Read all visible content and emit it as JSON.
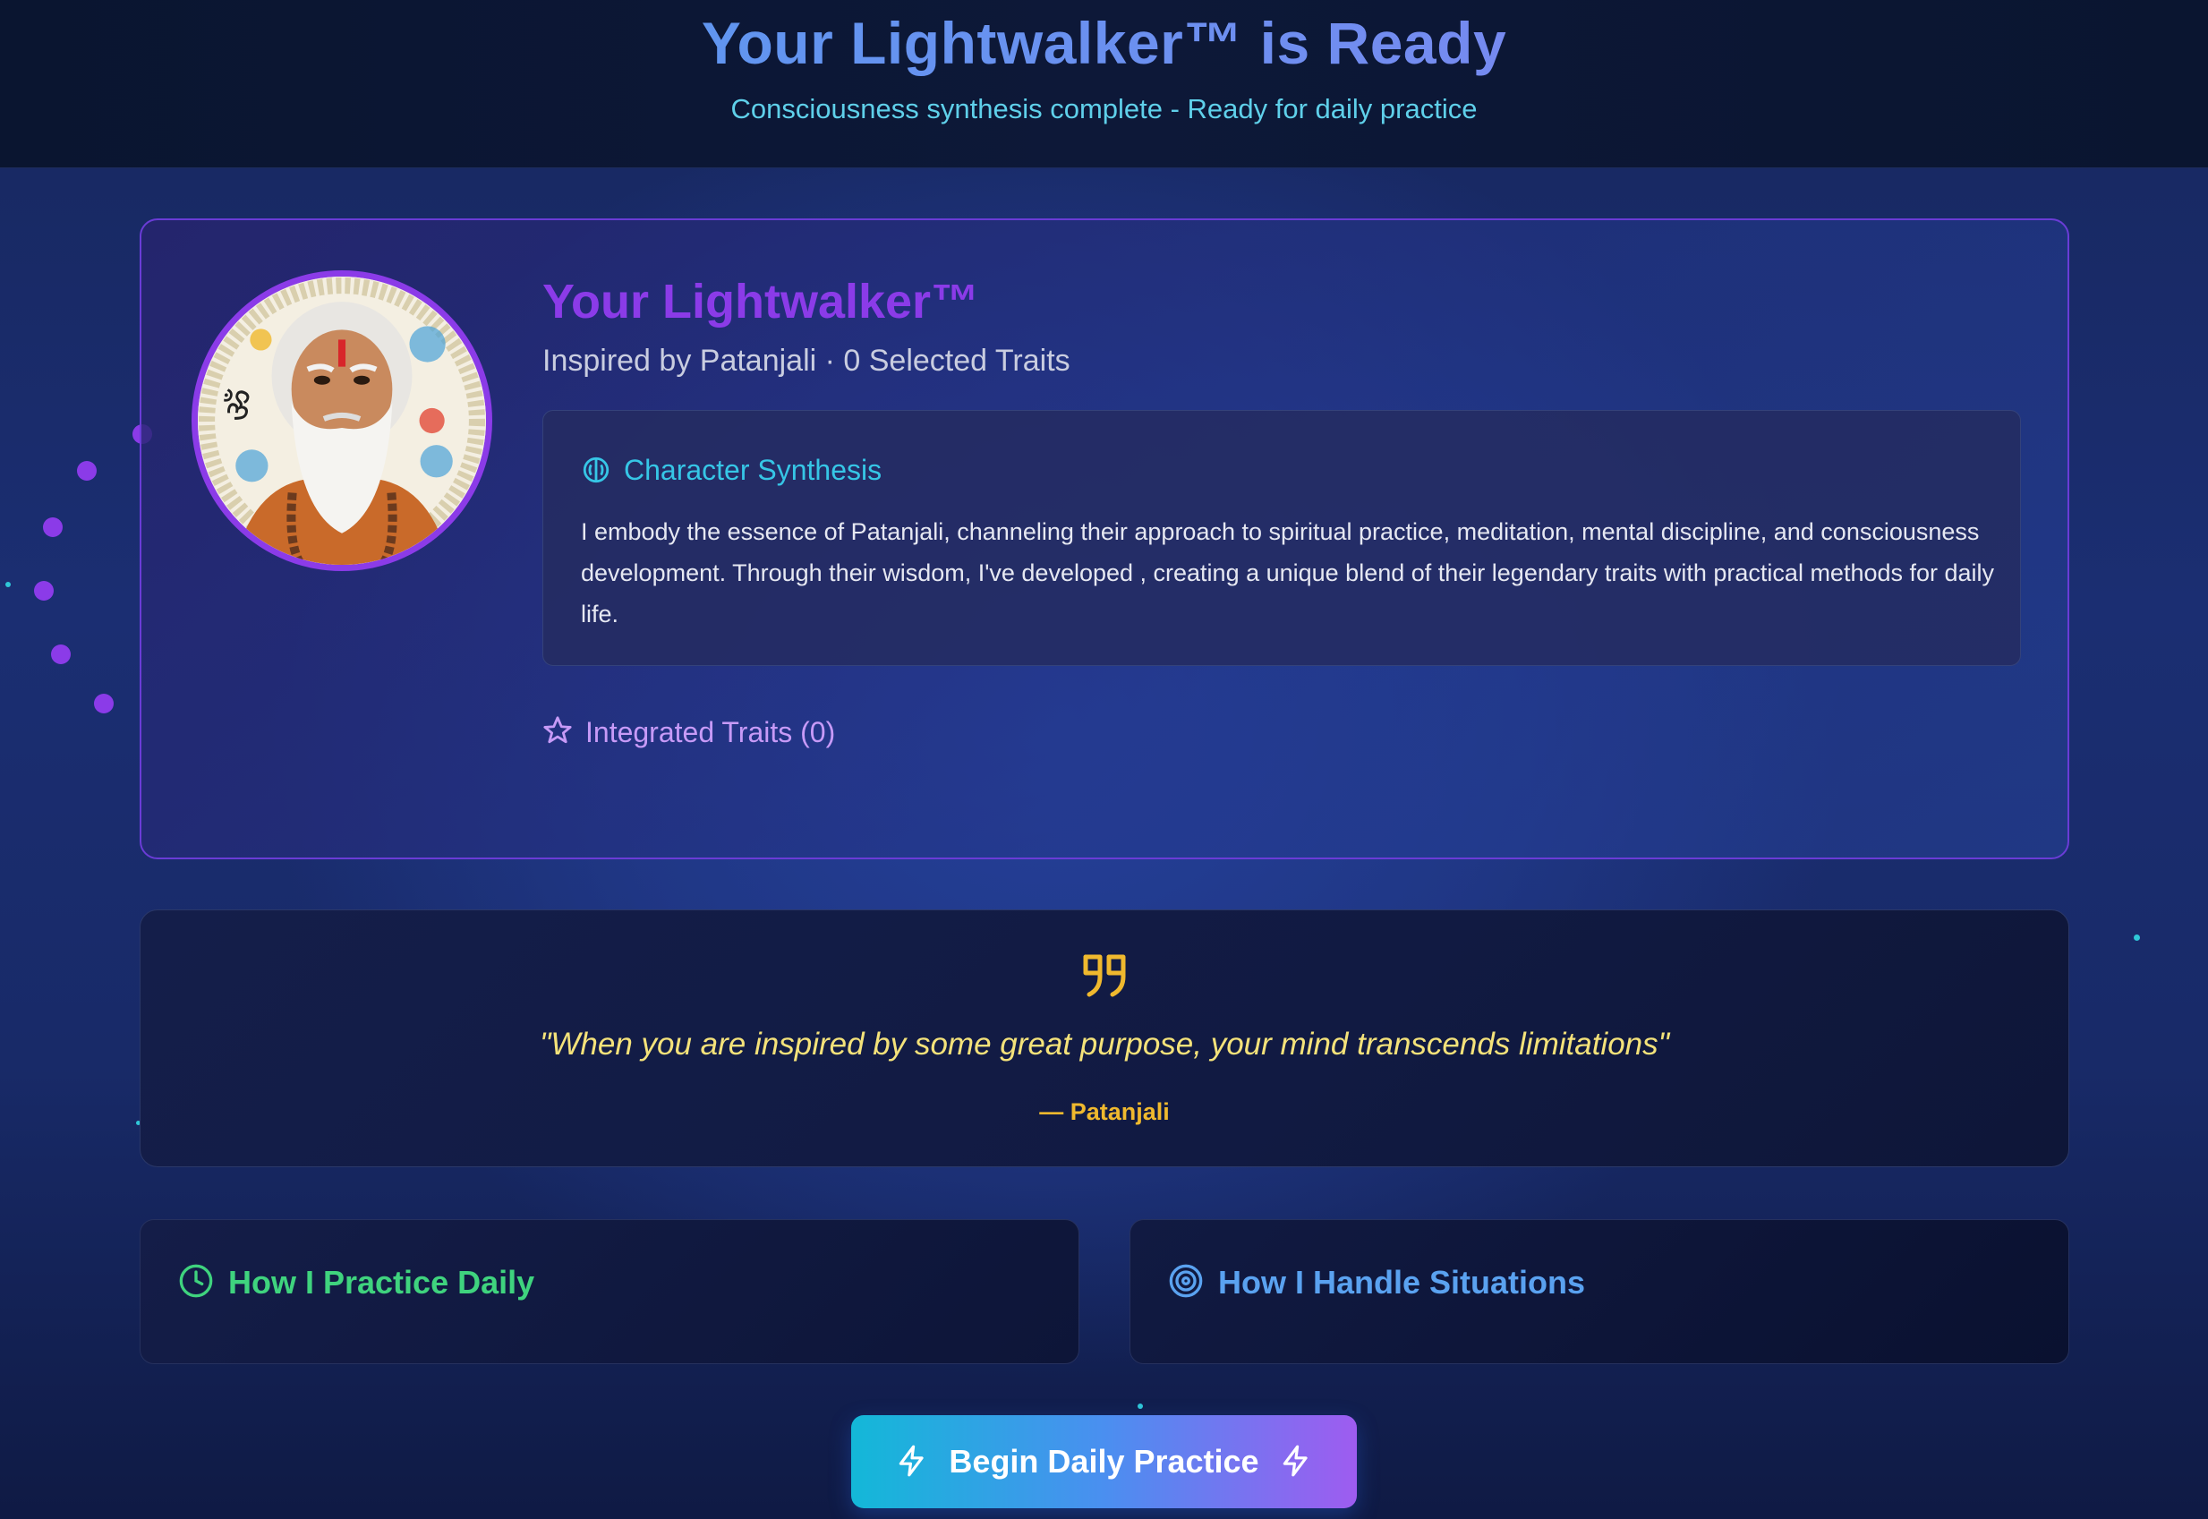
{
  "header": {
    "title": "Your Lightwalker™ is Ready",
    "subtitle": "Consciousness synthesis complete - Ready for daily practice"
  },
  "profile": {
    "avatar_icon": "patanjali-portrait",
    "title": "Your Lightwalker™",
    "subtitle": "Inspired by Patanjali · 0 Selected Traits",
    "synthesis": {
      "icon": "brain-icon",
      "title": "Character Synthesis",
      "text": "I embody the essence of Patanjali, channeling their approach to spiritual practice, meditation, mental discipline, and consciousness development. Through their wisdom, I've developed , creating a unique blend of their legendary traits with practical methods for daily life."
    },
    "traits": {
      "icon": "star-icon",
      "label": "Integrated Traits (0)"
    }
  },
  "quote": {
    "icon": "quote-icon",
    "text": "\"When you are inspired by some great purpose, your mind transcends limitations\"",
    "author": "— Patanjali"
  },
  "cards": {
    "daily": {
      "icon": "clock-icon",
      "title": "How I Practice Daily"
    },
    "situations": {
      "icon": "target-icon",
      "title": "How I Handle Situations"
    }
  },
  "cta": {
    "icon": "lightning-icon",
    "label": "Begin Daily Practice"
  },
  "colors": {
    "accent_purple": "#8b3be8",
    "accent_cyan": "#36c6e6",
    "accent_gold": "#f0b92e",
    "accent_green": "#3fd37e",
    "accent_blue": "#5aa2f0"
  }
}
